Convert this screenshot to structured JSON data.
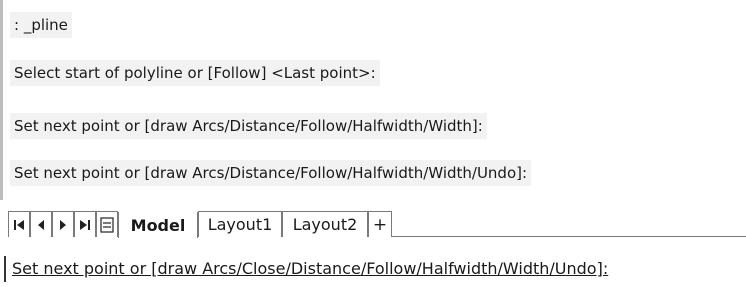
{
  "history": [
    ": _pline",
    "Select start of polyline or [Follow] <Last point>:",
    "Set next point or [draw Arcs/Distance/Follow/Halfwidth/Width]:",
    "Set next point or [draw Arcs/Distance/Follow/Halfwidth/Width/Undo]:"
  ],
  "tabs": {
    "nav_icons": [
      "first-page-icon",
      "previous-page-icon",
      "next-page-icon",
      "last-page-icon",
      "layout-list-icon"
    ],
    "items": [
      {
        "label": "Model",
        "active": true
      },
      {
        "label": "Layout1",
        "active": false
      },
      {
        "label": "Layout2",
        "active": false
      }
    ],
    "add_label": "+"
  },
  "command_line": {
    "prompt": "Set next point or [draw Arcs/Close/Distance/Follow/Halfwidth/Width/Undo]:"
  }
}
